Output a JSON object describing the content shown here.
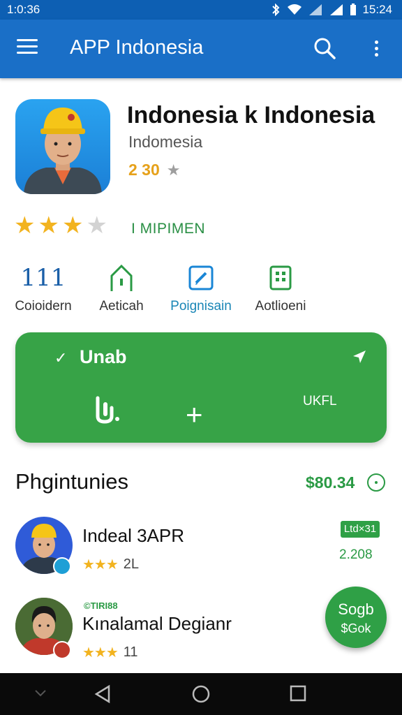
{
  "status_bar": {
    "time": "1:0:36",
    "clock": "15:24"
  },
  "app_bar": {
    "title": "APP Indonesia"
  },
  "app": {
    "name": "Indonesia k Indonesia",
    "developer": "Indomesia",
    "small_rating": "2 30",
    "rating_text": "I MIPIMEN",
    "stars": 3
  },
  "quick_actions": [
    {
      "label": "Coioidern",
      "icon": "111"
    },
    {
      "label": "Aeticah"
    },
    {
      "label": "Poignisain"
    },
    {
      "label": "Aotlioeni"
    }
  ],
  "card": {
    "title": "Unab",
    "right_label": "UKFL"
  },
  "section": {
    "title": "Phgintunies",
    "amount": "$80.34"
  },
  "list": [
    {
      "name": "Indeal 3APR",
      "count": "2L",
      "badge": "Ltd×31",
      "price": "2.208"
    },
    {
      "tag": "©TIRI88",
      "name": "Kınalamal Degianr",
      "count": "11"
    }
  ],
  "fab": {
    "line1": "Sogb",
    "line2": "$Gok"
  },
  "colors": {
    "primary": "#1a6fc7",
    "accent_green": "#37a347",
    "star": "#f2b31f"
  }
}
